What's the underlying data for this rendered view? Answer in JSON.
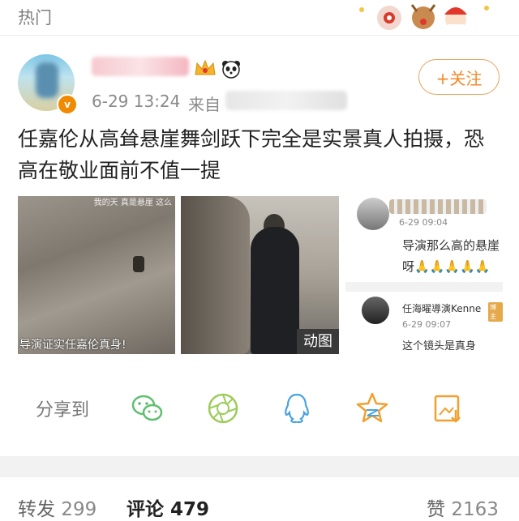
{
  "header": {
    "title": "热门"
  },
  "post": {
    "time": "6-29 13:24",
    "source_prefix": "来自",
    "follow_label": "+关注",
    "verified_mark": "v",
    "text": "任嘉伦从高耸悬崖舞剑跃下完全是实景真人拍摄，恐高在敬业面前不值一提"
  },
  "media": {
    "image1": {
      "caption": "导演证实任嘉伦真身!",
      "top_text": "我的天 真是悬崖 这么"
    },
    "image2": {
      "gif_label": "动图"
    },
    "image3": {
      "comment1_time": "6-29 09:04",
      "comment1_text": "导演那么高的悬崖呀🙏🙏🙏🙏🙏",
      "comment2_author": "任海曜導演Kenne",
      "comment2_badge": "博主",
      "comment2_time": "6-29 09:07",
      "comment2_text": "这个镜头是真身"
    }
  },
  "share": {
    "label": "分享到",
    "icons": [
      "wechat-icon",
      "moments-icon",
      "qq-icon",
      "qzone-icon",
      "save-image-icon"
    ]
  },
  "footer": {
    "repost_label": "转发",
    "repost_count": "299",
    "comment_label": "评论",
    "comment_count": "479",
    "like_label": "赞",
    "like_count": "2163"
  },
  "colors": {
    "accent": "#f08a2b",
    "share_green": "#5fbf6f",
    "share_blue": "#4aa3e0",
    "share_orange": "#f0a030"
  }
}
